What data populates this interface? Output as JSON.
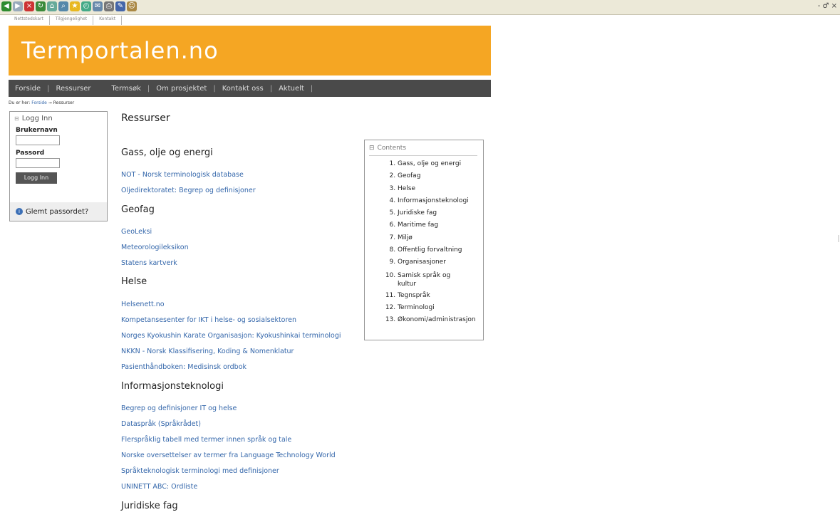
{
  "browser": {
    "right_label": "- ♂ ×"
  },
  "util_links": [
    "Nettstedskart",
    "Tilgjengelighet",
    "Kontakt"
  ],
  "site_title": "Termportalen.no",
  "nav": [
    "Forside",
    "Ressurser",
    "Termsøk",
    "Om prosjektet",
    "Kontakt oss",
    "Aktuelt"
  ],
  "breadcrumb": {
    "prefix": "Du er her:",
    "home": "Forside",
    "arrow": "→",
    "current": "Ressurser"
  },
  "login": {
    "header": "Logg Inn",
    "username_label": "Brukernavn",
    "password_label": "Passord",
    "button": "Logg Inn",
    "forgot": "Glemt passordet?"
  },
  "page_title": "Ressurser",
  "sections": [
    {
      "title": "Gass, olje og energi",
      "links": [
        "NOT - Norsk terminologisk database",
        "Oljedirektoratet: Begrep og definisjoner"
      ]
    },
    {
      "title": "Geofag",
      "links": [
        "GeoLeksi",
        "Meteorologileksikon",
        "Statens kartverk"
      ]
    },
    {
      "title": "Helse",
      "links": [
        "Helsenett.no",
        "Kompetansesenter for IKT i helse- og sosialsektoren",
        "Norges Kyokushin Karate Organisasjon: Kyokushinkai terminologi",
        "NKKN - Norsk Klassifisering, Koding & Nomenklatur",
        "Pasienthåndboken: Medisinsk ordbok"
      ]
    },
    {
      "title": "Informasjonsteknologi",
      "links": [
        "Begrep og definisjoner IT og helse",
        "Dataspråk (Språkrådet)",
        "Flerspråklig tabell med termer innen språk og tale",
        "Norske oversettelser av termer fra Language Technology World",
        "Språkteknologisk terminologi med definisjoner",
        "UNINETT ABC: Ordliste"
      ]
    },
    {
      "title": "Juridiske fag",
      "links": []
    }
  ],
  "toc": {
    "title": "Contents",
    "items": [
      "Gass, olje og energi",
      "Geofag",
      "Helse",
      "Informasjonsteknologi",
      "Juridiske fag",
      "Maritime fag",
      "Miljø",
      "Offentlig forvaltning",
      "Organisasjoner",
      "Samisk språk og kultur",
      "Tegnspråk",
      "Terminologi",
      "Økonomi/administrasjon"
    ]
  }
}
